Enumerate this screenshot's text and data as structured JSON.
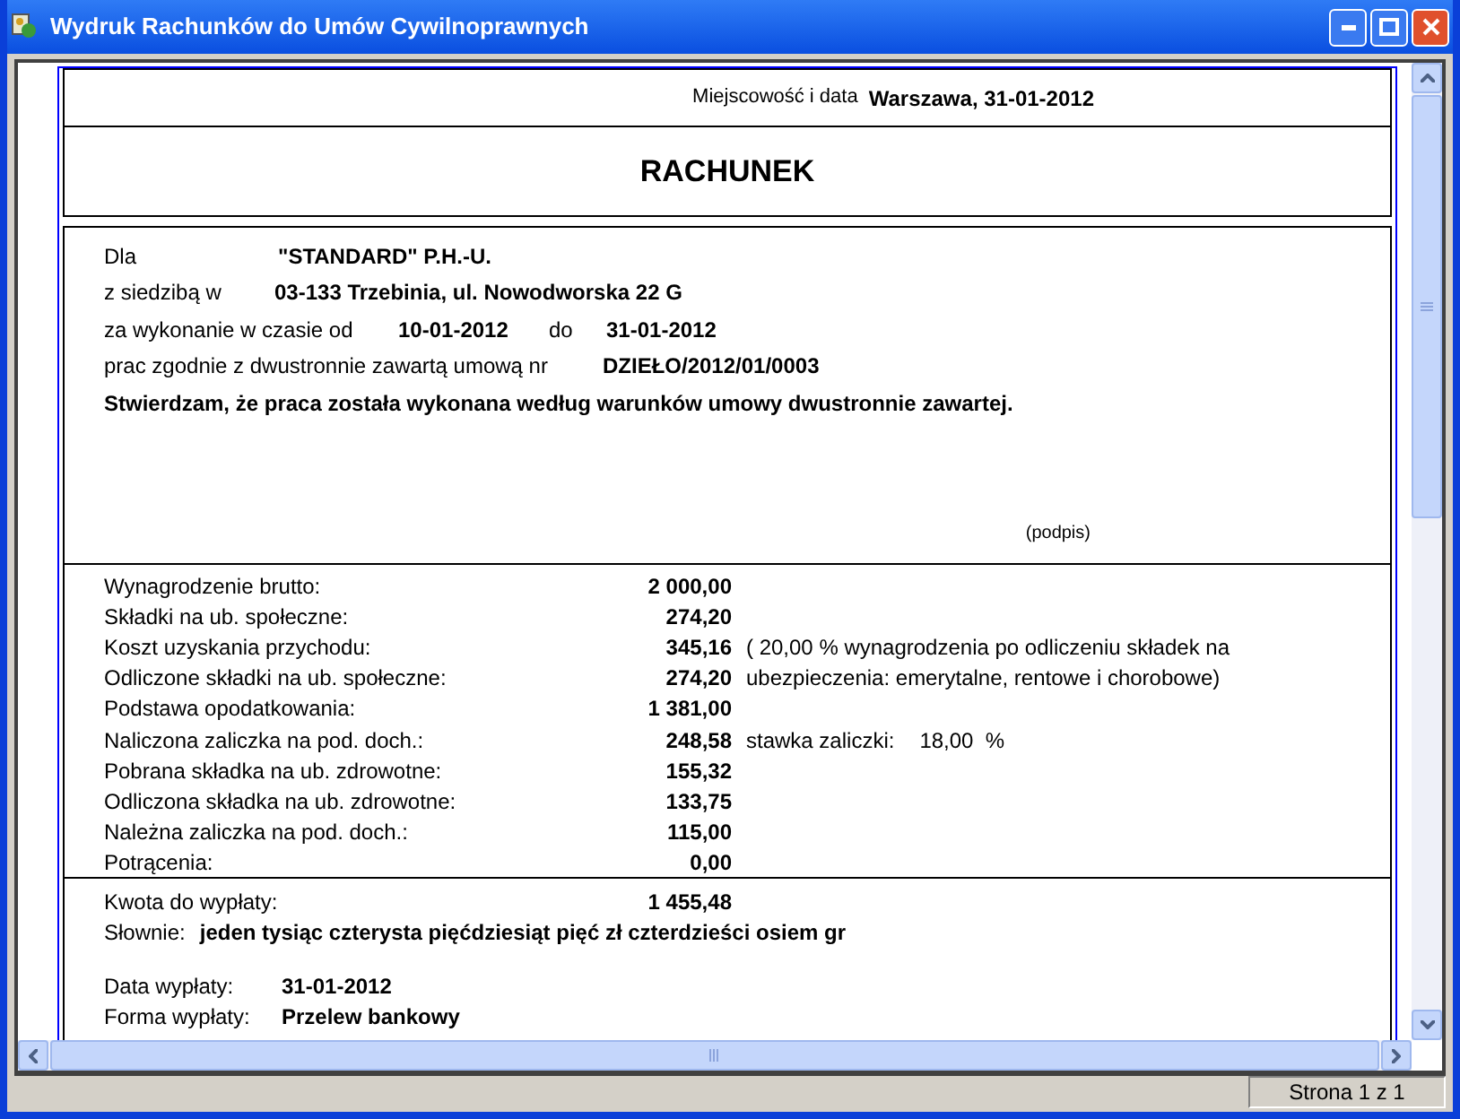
{
  "window": {
    "title": "Wydruk Rachunków do Umów Cywilnoprawnych"
  },
  "header": {
    "place_label": "Miejscowość i data",
    "place_value": "Warszawa, 31-01-2012"
  },
  "title": "RACHUNEK",
  "parties": [
    {
      "label": "Dla",
      "value": "\"STANDARD\" P.H.-U."
    },
    {
      "label": "z siedzibą w",
      "value": "03-133 Trzebinia, ul. Nowodworska 22 G"
    }
  ],
  "period": {
    "label": "za wykonanie w czasie od",
    "from": "10-01-2012",
    "to_label": "do",
    "to": "31-01-2012"
  },
  "contract": {
    "label": "prac zgodnie z dwustronnie zawartą umową nr",
    "value": "DZIEŁO/2012/01/0003"
  },
  "statement": "Stwierdzam, że praca została wykonana według warunków umowy dwustronnie zawartej.",
  "signature_label": "(podpis)",
  "amounts": [
    {
      "label": "Wynagrodzenie brutto:",
      "value": "2 000,00"
    },
    {
      "label": "Składki na ub. społeczne:",
      "value": "274,20"
    },
    {
      "label": "Koszt uzyskania przychodu:",
      "value": "345,16",
      "note": "( 20,00 % wynagrodzenia po odliczeniu składek na"
    },
    {
      "label": "Odliczone składki na ub. społeczne:",
      "value": "274,20",
      "note": "ubezpieczenia: emerytalne, rentowe i chorobowe)"
    },
    {
      "label": "Podstawa opodatkowania:",
      "value": "1 381,00"
    },
    {
      "label": "Naliczona zaliczka na pod. doch.:",
      "value": "248,58",
      "note": "stawka zaliczki:",
      "note_value": "18,00  %"
    },
    {
      "label": "Pobrana składka na ub. zdrowotne:",
      "value": "155,32"
    },
    {
      "label": "Odliczona składka na ub. zdrowotne:",
      "value": "133,75"
    },
    {
      "label": "Należna zaliczka na pod. doch.:",
      "value": "115,00"
    },
    {
      "label": "Potrącenia:",
      "value": "0,00"
    }
  ],
  "payout": {
    "amount_label": "Kwota do wypłaty:",
    "amount": "1 455,48",
    "words_label": "Słownie:",
    "words": "jeden tysiąc czterysta pięćdziesiąt pięć zł czterdzieści osiem gr",
    "details": [
      {
        "label": "Data wypłaty:",
        "value": "31-01-2012"
      },
      {
        "label": "Forma wypłaty:",
        "value": "Przelew bankowy"
      }
    ]
  },
  "status_bar": {
    "page": "Strona 1 z 1"
  }
}
